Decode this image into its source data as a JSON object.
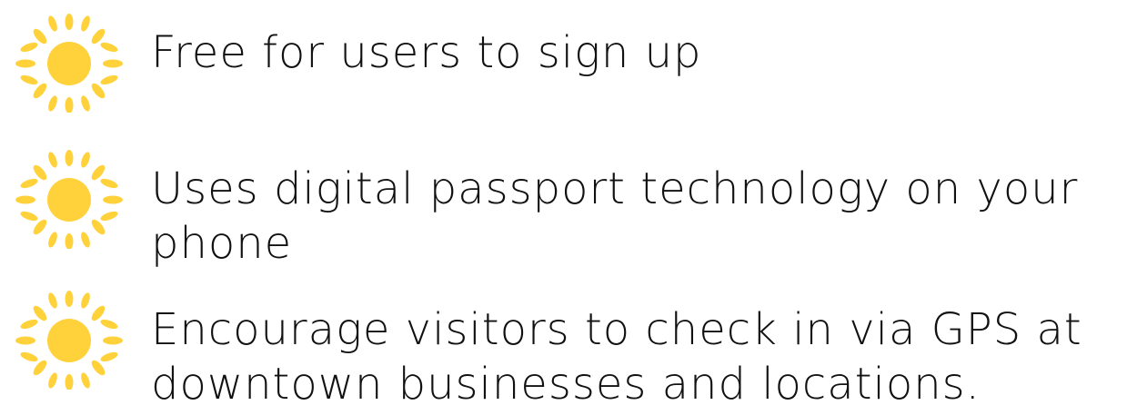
{
  "bullets": [
    {
      "icon": "sun-icon",
      "lines": [
        "Free for users to sign up"
      ]
    },
    {
      "icon": "sun-icon",
      "lines": [
        "Uses digital passport technology on your",
        "phone"
      ]
    },
    {
      "icon": "sun-icon",
      "lines": [
        "Encourage visitors to check in via GPS at",
        "downtown businesses and locations."
      ]
    }
  ],
  "colors": {
    "sun": "#FFD23C",
    "text": "#111111"
  }
}
